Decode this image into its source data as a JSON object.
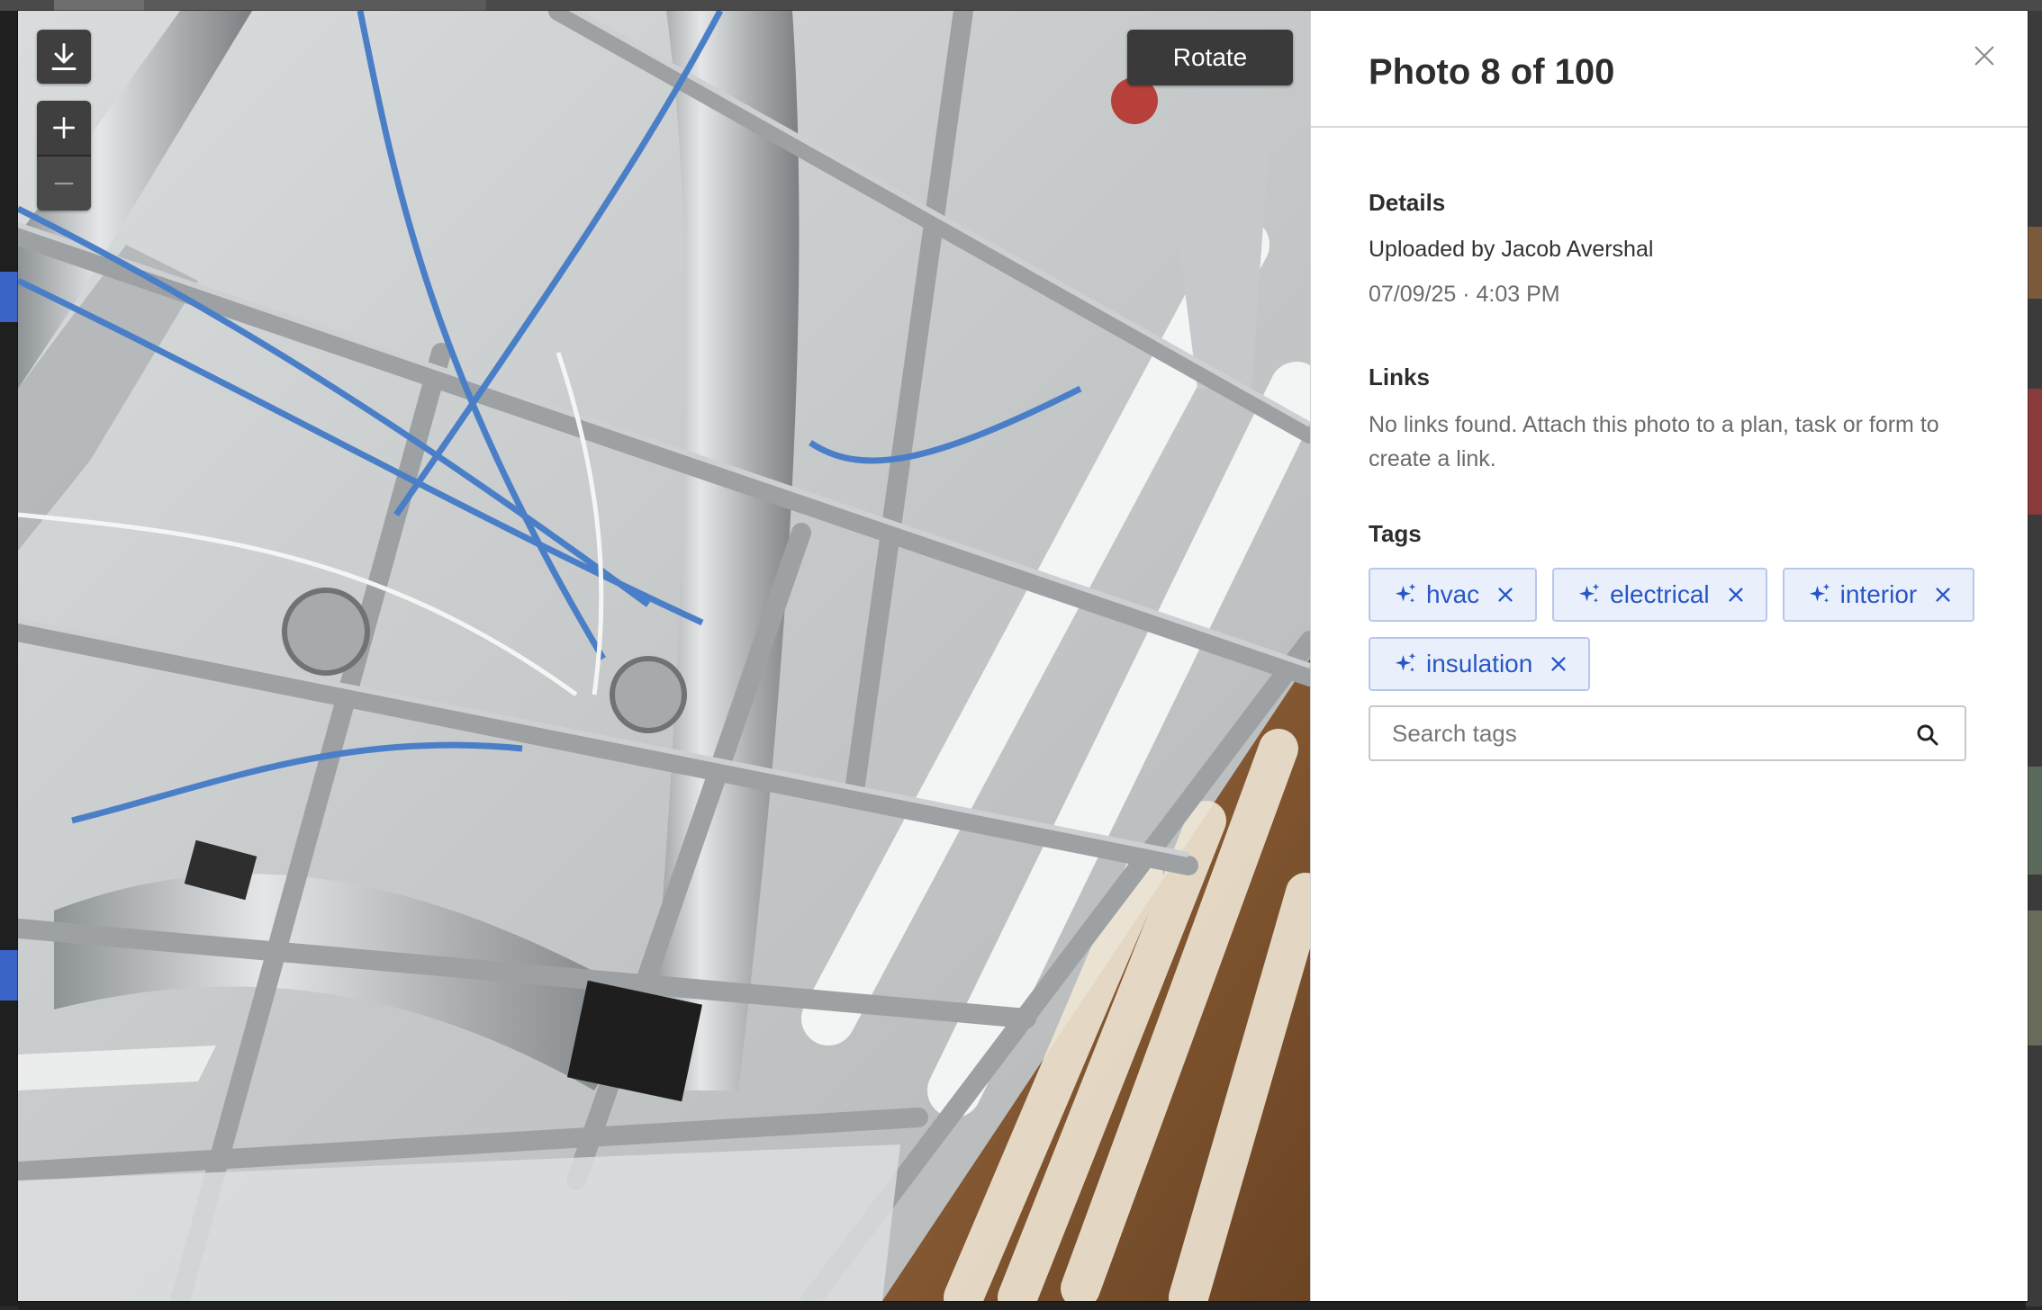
{
  "viewer": {
    "rotate_label": "Rotate"
  },
  "panel": {
    "title": "Photo 8 of 100",
    "details": {
      "heading": "Details",
      "uploaded_by": "Uploaded by Jacob Avershal",
      "timestamp": "07/09/25 · 4:03 PM"
    },
    "links": {
      "heading": "Links",
      "empty_text": "No links found. Attach this photo to a plan, task or form to create a link."
    },
    "tags": {
      "heading": "Tags",
      "items": [
        "hvac",
        "electrical",
        "interior",
        "insulation"
      ],
      "search_placeholder": "Search tags"
    }
  },
  "colors": {
    "tag_text": "#2856c7",
    "tag_bg": "#eaf0fb",
    "tag_border": "#b8c8ea",
    "toolbar_bg": "#3f3f3f"
  }
}
